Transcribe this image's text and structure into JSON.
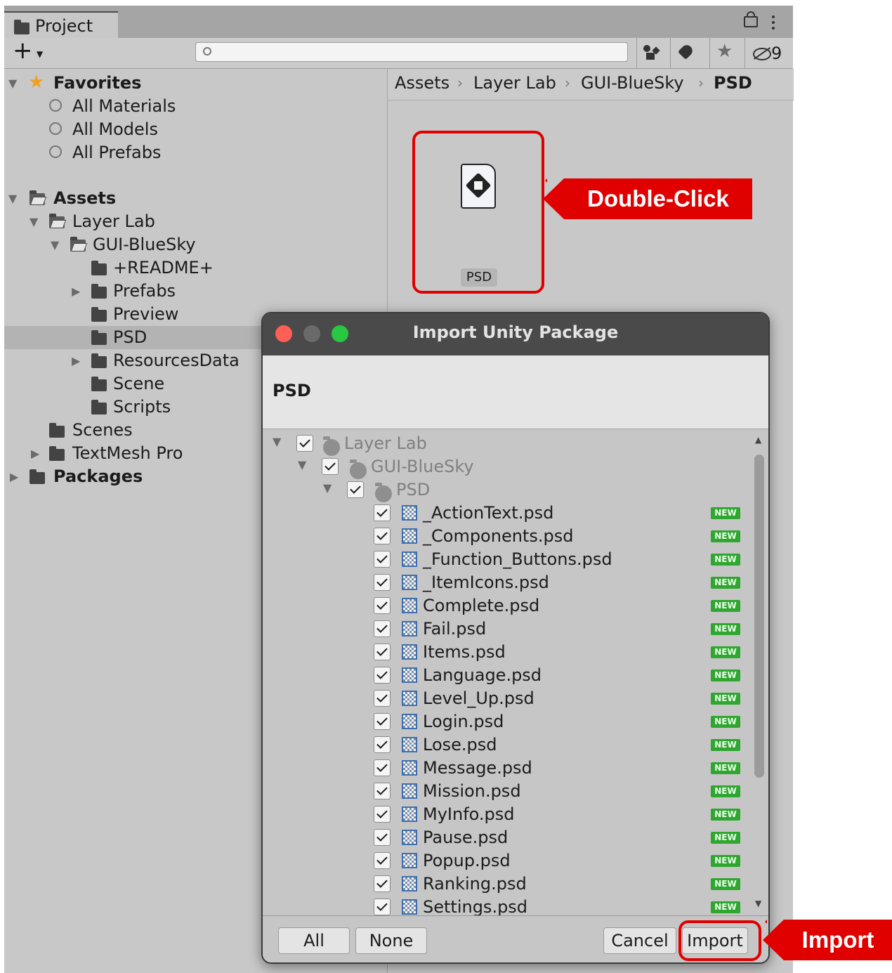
{
  "project_window": {
    "tab_label": "Project",
    "add_label": "+",
    "search": {
      "value": "",
      "placeholder": ""
    },
    "toolbar": {
      "hidden_count": "9"
    },
    "breadcrumb": [
      "Assets",
      "Layer Lab",
      "GUI-BlueSky",
      "PSD"
    ],
    "tree": {
      "favorites": {
        "label": "Favorites",
        "items": [
          "All Materials",
          "All Models",
          "All Prefabs"
        ]
      },
      "assets": "Assets",
      "layer_lab": "Layer Lab",
      "gui_bluesky": "GUI-BlueSky",
      "children": [
        "+README+",
        "Prefabs",
        "Preview",
        "PSD",
        "ResourcesData",
        "Scene",
        "Scripts"
      ],
      "scenes": "Scenes",
      "textmesh": "TextMesh Pro",
      "packages": "Packages"
    },
    "asset": {
      "label": "PSD"
    }
  },
  "callouts": {
    "double_click": "Double-Click",
    "import": "Import"
  },
  "dialog": {
    "title": "Import Unity Package",
    "package_name": "PSD",
    "folders": [
      "Layer Lab",
      "GUI-BlueSky",
      "PSD"
    ],
    "new_badge": "NEW",
    "files": [
      "_ActionText.psd",
      "_Components.psd",
      "_Function_Buttons.psd",
      "_ItemIcons.psd",
      "Complete.psd",
      "Fail.psd",
      "Items.psd",
      "Language.psd",
      "Level_Up.psd",
      "Login.psd",
      "Lose.psd",
      "Message.psd",
      "Mission.psd",
      "MyInfo.psd",
      "Pause.psd",
      "Popup.psd",
      "Ranking.psd",
      "Settings.psd"
    ],
    "buttons": {
      "all": "All",
      "none": "None",
      "cancel": "Cancel",
      "import": "Import"
    }
  }
}
